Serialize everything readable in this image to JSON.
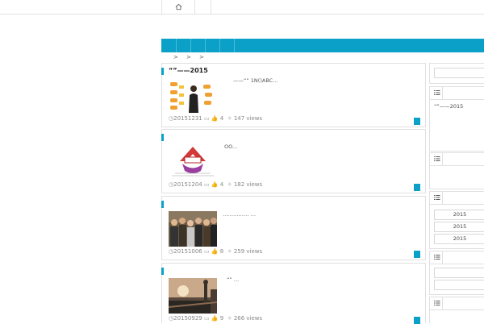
{
  "breadcrumb": [
    ">",
    ">",
    ">"
  ],
  "posts": [
    {
      "title": "“”——2015",
      "excerpt": "——“” 1N()ABC...",
      "date": "20151231",
      "comments": "",
      "likes": "4",
      "views": "147 views"
    },
    {
      "title": "",
      "excerpt": "OO...",
      "date": "20151204",
      "comments": "",
      "likes": "4",
      "views": "182 views"
    },
    {
      "title": "",
      "excerpt": "…………… …",
      "date": "20151006",
      "comments": "",
      "likes": "8",
      "views": "259 views"
    },
    {
      "title": "",
      "excerpt": "“” …",
      "date": "20150929",
      "comments": "",
      "likes": "9",
      "views": "266 views"
    }
  ],
  "sidebar": {
    "recent": [
      "“”——2015"
    ],
    "archives": [
      "2015",
      "2015",
      "2015"
    ]
  },
  "colors": {
    "accent": "#0aa0c8"
  }
}
